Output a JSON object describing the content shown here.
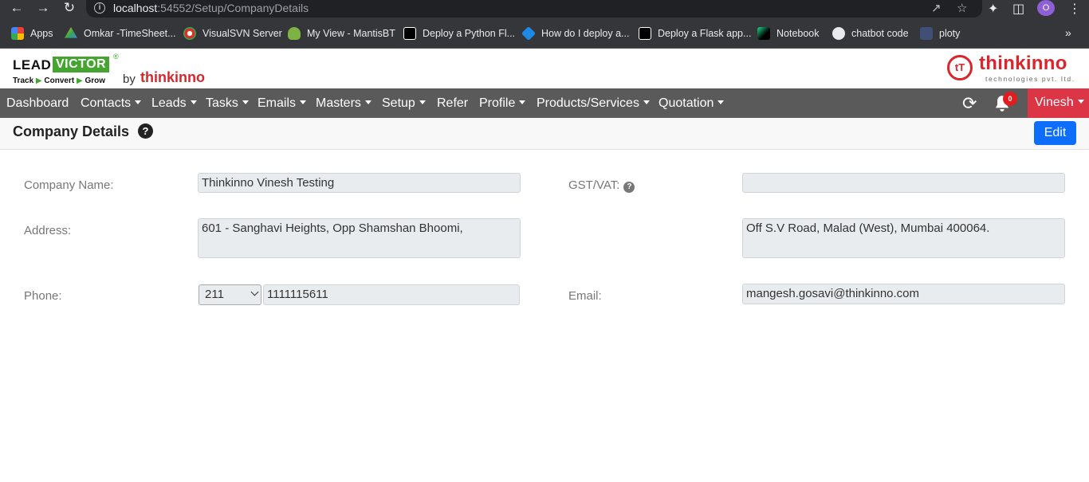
{
  "browser": {
    "url_host": "localhost",
    "url_path": ":54552/Setup/CompanyDetails",
    "profile_initial": "O",
    "bookmarks": [
      {
        "label": "Apps",
        "icon": "apps-grid-icon",
        "color": "#ea4335"
      },
      {
        "label": "Omkar -TimeSheet...",
        "icon": "drive-icon",
        "color": "#fbbc04"
      },
      {
        "label": "VisualSVN Server",
        "icon": "visualsvn-icon",
        "color": "#d93025"
      },
      {
        "label": "My View - MantisBT",
        "icon": "mantis-icon",
        "color": "#7cb342"
      },
      {
        "label": "Deploy a Python Fl...",
        "icon": "medium-icon",
        "color": "#000000"
      },
      {
        "label": "How do I deploy a...",
        "icon": "stackshare-icon",
        "color": "#1e88e5"
      },
      {
        "label": "Deploy a Flask app...",
        "icon": "medium-icon",
        "color": "#000000"
      },
      {
        "label": "Notebook",
        "icon": "pycharm-icon",
        "color": "#21d789"
      },
      {
        "label": "chatbot code",
        "icon": "github-icon",
        "color": "#e8eaed"
      },
      {
        "label": "ploty",
        "icon": "plotly-icon",
        "color": "#3f4f75"
      }
    ]
  },
  "header": {
    "brand_lead": "LEAD",
    "brand_victor": "VICTOR",
    "brand_tag_1": "Track",
    "brand_tag_2": "Convert",
    "brand_tag_3": "Grow",
    "by": "by",
    "by_brand": "thinkinno",
    "company_logo_name": "thinkinno",
    "company_logo_sub": "technologies pvt. ltd."
  },
  "nav": {
    "items": [
      {
        "label": "Dashboard",
        "dropdown": false
      },
      {
        "label": "Contacts",
        "dropdown": true
      },
      {
        "label": "Leads",
        "dropdown": true
      },
      {
        "label": "Tasks",
        "dropdown": true
      },
      {
        "label": "Emails",
        "dropdown": true
      },
      {
        "label": "Masters",
        "dropdown": true
      },
      {
        "label": "Setup",
        "dropdown": true
      },
      {
        "label": "Refer",
        "dropdown": false
      },
      {
        "label": "Profile",
        "dropdown": true
      },
      {
        "label": "Products/Services",
        "dropdown": true
      },
      {
        "label": "Quotation",
        "dropdown": true
      }
    ],
    "notification_count": "0",
    "user_name": "Vinesh"
  },
  "page": {
    "title": "Company Details",
    "edit_label": "Edit"
  },
  "form": {
    "company_name_label": "Company Name:",
    "company_name": "Thinkinno Vinesh Testing",
    "gst_label": "GST/VAT:",
    "gst": "",
    "address_label": "Address:",
    "address_line1": "601 - Sanghavi Heights, Opp Shamshan Bhoomi,",
    "address_line2": "Off S.V Road, Malad (West), Mumbai 400064.",
    "phone_label": "Phone:",
    "phone_code": "211",
    "phone_number": "1111115611",
    "email_label": "Email:",
    "email": "mangesh.gosavi@thinkinno.com"
  },
  "colors": {
    "navbar": "#5a5a5a",
    "user_button": "#dc3545",
    "edit_button": "#0d6efd",
    "brand_green": "#46a530",
    "brand_red": "#d9262c"
  }
}
